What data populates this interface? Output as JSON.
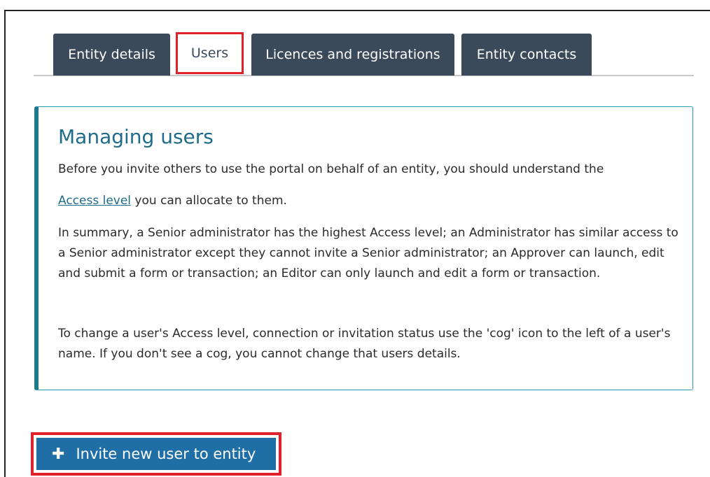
{
  "tabs": [
    {
      "label": "Entity details"
    },
    {
      "label": "Users"
    },
    {
      "label": "Licences and registrations"
    },
    {
      "label": "Entity contacts"
    }
  ],
  "info": {
    "title": "Managing users",
    "p1": "Before you invite others to use the portal on behalf of an entity, you should understand the",
    "p2_link": "Access level",
    "p2_rest": " you can allocate to them.",
    "p3": "In summary, a Senior administrator has the highest Access level; an Administrator has similar access to a Senior administrator except they cannot invite a Senior administrator; an Approver can launch, edit and submit a form or transaction; an Editor can only launch and edit a form or transaction.",
    "p4": "To change a user's Access level, connection or invitation status use the 'cog' icon to the left of a user's name. If you don't see a cog, you cannot change that users details."
  },
  "invite_button": {
    "icon": "plus-icon",
    "label": "Invite new user to entity"
  },
  "colors": {
    "tab_bg": "#3b4a5a",
    "highlight": "#e0202a",
    "accent": "#1e6b8a",
    "button_bg": "#1f6fa6"
  }
}
